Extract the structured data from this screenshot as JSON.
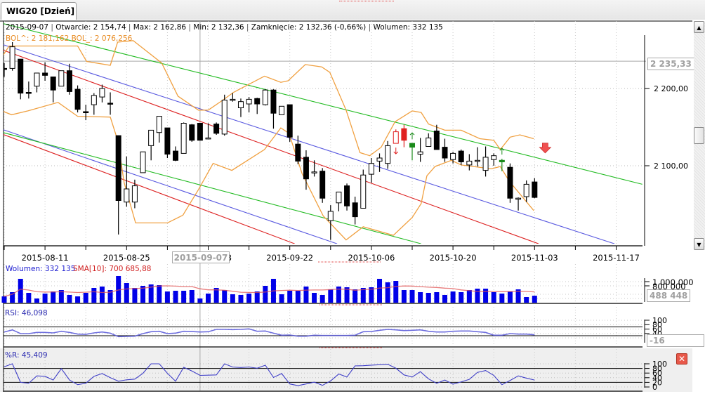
{
  "tab": {
    "label": "WIG20 [Dzień]"
  },
  "info_line": {
    "date": "2015-09-07",
    "open": "Otwarcie: 2 154,74",
    "max": "Max: 2 162,86",
    "min": "Min: 2 132,36",
    "close": "Zamknięcie: 2 132,36 (-0,66%)",
    "volume": "Wolumen: 332 135"
  },
  "bollinger_label": "BOL^: 2 181,162  BOL_: 2 076,256",
  "crosshair": {
    "price_label": "2 235,33",
    "price": 2235.33,
    "date_label": "2015-09-07",
    "index": 24
  },
  "price_axis": {
    "ticks": [
      {
        "value": 2200,
        "label": "2 200,00"
      },
      {
        "value": 2100,
        "label": "2 100,00"
      }
    ]
  },
  "date_axis": [
    {
      "index": 5,
      "label": "2015-08-11"
    },
    {
      "index": 15,
      "label": "2015-08-25"
    },
    {
      "index": 25,
      "label": "2015-09-08"
    },
    {
      "index": 35,
      "label": "2015-09-22"
    },
    {
      "index": 45,
      "label": "2015-10-06"
    },
    {
      "index": 55,
      "label": "2015-10-20"
    },
    {
      "index": 65,
      "label": "2015-11-03"
    },
    {
      "index": 75,
      "label": "2015-11-17"
    }
  ],
  "volume_panel": {
    "label": "Wolumen: 332 135",
    "sma_label": "SMA[10]: 700 685,88",
    "axis_ticks": [
      {
        "value": 1000000,
        "label": "1 000 000"
      },
      {
        "value": 800000,
        "label": "800 000"
      }
    ],
    "crosshair_box": "488 448"
  },
  "rsi_panel": {
    "label": "RSI: 46,098",
    "axis_ticks": [
      {
        "value": 100,
        "label": "100"
      },
      {
        "value": 80,
        "label": "80"
      },
      {
        "value": 60,
        "label": "60"
      },
      {
        "value": 40,
        "label": "40"
      }
    ],
    "crosshair_box": "-16",
    "levels": [
      70,
      30
    ]
  },
  "wr_panel": {
    "label": "%R: 45,409",
    "axis_ticks": [
      {
        "value": 100,
        "label": "100"
      },
      {
        "value": 80,
        "label": "80"
      },
      {
        "value": 60,
        "label": "60"
      },
      {
        "value": 40,
        "label": "40"
      },
      {
        "value": 20,
        "label": "20"
      },
      {
        "value": 0,
        "label": "0"
      }
    ],
    "levels": [
      80,
      20
    ],
    "close_icon": "close-icon"
  },
  "colors": {
    "up": "#ffffff",
    "down": "#000000",
    "bands": "#f0a040",
    "volume": "#0000e8",
    "sma": "#e05050",
    "rsi": "#5555d8",
    "wr": "#4040c8",
    "signal_red": "#e02020",
    "signal_green": "#1a8a1a",
    "line_green": "#22bb22",
    "line_blue": "#5a5ae0",
    "line_red": "#dd2222"
  },
  "chart_data": {
    "type": "candlestick",
    "title": "WIG20 [Dzień]",
    "ylim": [
      1999,
      2287
    ],
    "candles_ohlc": [
      [
        2226,
        2233,
        2215,
        2225
      ],
      [
        2226,
        2260,
        2223,
        2254
      ],
      [
        2238,
        2238,
        2186,
        2194
      ],
      [
        2195,
        2209,
        2187,
        2194
      ],
      [
        2203,
        2220,
        2195,
        2220
      ],
      [
        2220,
        2234,
        2210,
        2217
      ],
      [
        2215,
        2215,
        2182,
        2198
      ],
      [
        2203,
        2223,
        2203,
        2223
      ],
      [
        2223,
        2232,
        2192,
        2196
      ],
      [
        2199,
        2204,
        2169,
        2173
      ],
      [
        2170,
        2179,
        2159,
        2169
      ],
      [
        2179,
        2194,
        2166,
        2191
      ],
      [
        2189,
        2205,
        2182,
        2200
      ],
      [
        2181,
        2195,
        2166,
        2180
      ],
      [
        2139,
        2139,
        2011,
        2055
      ],
      [
        2053,
        2112,
        2047,
        2070
      ],
      [
        2053,
        2082,
        2045,
        2074
      ],
      [
        2091,
        2118,
        2091,
        2118
      ],
      [
        2126,
        2146,
        2107,
        2146
      ],
      [
        2143,
        2164,
        2130,
        2164
      ],
      [
        2149,
        2149,
        2110,
        2115
      ],
      [
        2119,
        2125,
        2106,
        2107
      ],
      [
        2116,
        2156,
        2116,
        2155
      ],
      [
        2153,
        2154,
        2131,
        2133
      ],
      [
        2155,
        2155,
        2133,
        2133
      ],
      [
        2136,
        2155,
        2135,
        2136
      ],
      [
        2154,
        2156,
        2140,
        2142
      ],
      [
        2141,
        2192,
        2139,
        2185
      ],
      [
        2186,
        2194,
        2183,
        2186
      ],
      [
        2175,
        2187,
        2163,
        2183
      ],
      [
        2180,
        2189,
        2169,
        2186
      ],
      [
        2187,
        2188,
        2167,
        2180
      ],
      [
        2179,
        2199,
        2178,
        2198
      ],
      [
        2198,
        2199,
        2148,
        2168
      ],
      [
        2166,
        2177,
        2166,
        2177
      ],
      [
        2179,
        2179,
        2131,
        2137
      ],
      [
        2128,
        2139,
        2102,
        2106
      ],
      [
        2111,
        2120,
        2069,
        2083
      ],
      [
        2092,
        2107,
        2086,
        2092
      ],
      [
        2093,
        2097,
        2052,
        2058
      ],
      [
        2029,
        2049,
        2004,
        2041
      ],
      [
        2052,
        2066,
        2041,
        2066
      ],
      [
        2074,
        2077,
        2042,
        2048
      ],
      [
        2052,
        2060,
        2024,
        2034
      ],
      [
        2045,
        2095,
        2045,
        2088
      ],
      [
        2089,
        2110,
        2078,
        2103
      ],
      [
        2106,
        2116,
        2092,
        2110
      ],
      [
        2103,
        2132,
        2096,
        2126
      ],
      [
        2129,
        2147,
        2129,
        2144
      ],
      [
        2148,
        2153,
        2124,
        2133
      ],
      [
        2129,
        2129,
        2107,
        2124
      ],
      [
        2115,
        2136,
        2105,
        2118
      ],
      [
        2125,
        2142,
        2125,
        2136
      ],
      [
        2145,
        2153,
        2121,
        2121
      ],
      [
        2124,
        2135,
        2105,
        2110
      ],
      [
        2108,
        2118,
        2103,
        2116
      ],
      [
        2119,
        2121,
        2101,
        2105
      ],
      [
        2101,
        2115,
        2094,
        2106
      ],
      [
        2107,
        2124,
        2099,
        2107
      ],
      [
        2094,
        2125,
        2086,
        2111
      ],
      [
        2108,
        2116,
        2100,
        2113
      ],
      [
        2107,
        2109,
        2093,
        2105
      ],
      [
        2098,
        2103,
        2052,
        2058
      ],
      [
        2058,
        2059,
        2042,
        2058
      ],
      [
        2060,
        2081,
        2053,
        2076
      ],
      [
        2079,
        2084,
        2058,
        2059
      ]
    ],
    "candle_highlights": {
      "48": "red-hollow",
      "49": "red",
      "50": "green",
      "61": "green"
    },
    "signals": [
      {
        "index": 48,
        "price": 2119,
        "type": "down",
        "color": "red"
      },
      {
        "index": 50,
        "price": 2139,
        "type": "up",
        "color": "green"
      },
      {
        "index": 61,
        "price": 2119,
        "type": "up",
        "color": "green"
      }
    ],
    "big_signal": {
      "index": 66.3,
      "price": 2122,
      "type": "down"
    },
    "bollinger_upper": [
      [
        -0.5,
        2237
      ],
      [
        0.6,
        2255
      ],
      [
        9,
        2255
      ],
      [
        10.1,
        2235
      ],
      [
        13,
        2230
      ],
      [
        13.9,
        2260
      ],
      [
        15.8,
        2262
      ],
      [
        19.3,
        2233
      ],
      [
        21.3,
        2190
      ],
      [
        23.8,
        2172
      ],
      [
        25,
        2172
      ],
      [
        26.8,
        2185
      ],
      [
        28.1,
        2195
      ],
      [
        31.9,
        2216
      ],
      [
        33.9,
        2208
      ],
      [
        34.8,
        2210
      ],
      [
        36.9,
        2231
      ],
      [
        38.9,
        2228
      ],
      [
        39.9,
        2221
      ],
      [
        41.9,
        2172
      ],
      [
        43.6,
        2117
      ],
      [
        44.8,
        2113
      ],
      [
        46.2,
        2124
      ],
      [
        47.9,
        2157
      ],
      [
        50,
        2171
      ],
      [
        51.1,
        2169
      ],
      [
        52,
        2154
      ],
      [
        54,
        2146
      ],
      [
        56,
        2146
      ],
      [
        58.3,
        2135
      ],
      [
        60,
        2133
      ],
      [
        60.8,
        2121
      ],
      [
        62,
        2137
      ],
      [
        63.2,
        2140
      ],
      [
        64.9,
        2135
      ]
    ],
    "bollinger_lower": [
      [
        -0.5,
        2172
      ],
      [
        0.9,
        2166
      ],
      [
        2.9,
        2171
      ],
      [
        6.6,
        2182
      ],
      [
        9,
        2164
      ],
      [
        13,
        2163
      ],
      [
        13.9,
        2133
      ],
      [
        14.7,
        2078
      ],
      [
        16.1,
        2026
      ],
      [
        20,
        2026
      ],
      [
        21.9,
        2036
      ],
      [
        23.8,
        2069
      ],
      [
        25.6,
        2103
      ],
      [
        27.9,
        2094
      ],
      [
        31.9,
        2121
      ],
      [
        33.9,
        2149
      ],
      [
        34.9,
        2142
      ],
      [
        36.5,
        2090
      ],
      [
        39.1,
        2035
      ],
      [
        41.9,
        2004
      ],
      [
        44,
        2021
      ],
      [
        47.7,
        2010
      ],
      [
        50,
        2033
      ],
      [
        51.1,
        2051
      ],
      [
        51.8,
        2087
      ],
      [
        52.8,
        2099
      ],
      [
        54.8,
        2107
      ],
      [
        56,
        2101
      ],
      [
        59.7,
        2096
      ],
      [
        60.8,
        2099
      ],
      [
        61.9,
        2080
      ],
      [
        64.9,
        2042
      ]
    ],
    "trend_lines": [
      {
        "color": "green",
        "from": [
          -0.5,
          2285
        ],
        "to": [
          78.2,
          2076
        ]
      },
      {
        "color": "blue",
        "from": [
          -0.5,
          2258
        ],
        "to": [
          74.8,
          1999
        ]
      },
      {
        "color": "red",
        "from": [
          -0.5,
          2251
        ],
        "to": [
          65.5,
          1999
        ]
      },
      {
        "color": "blue",
        "from": [
          -0.5,
          2148
        ],
        "to": [
          40.8,
          1999
        ]
      },
      {
        "color": "green",
        "from": [
          -0.5,
          2144
        ],
        "to": [
          51.1,
          1999
        ]
      },
      {
        "color": "red",
        "from": [
          -0.5,
          2142
        ],
        "to": [
          35.6,
          1999
        ]
      }
    ],
    "volume": [
      300000,
      500000,
      1133000,
      467000,
      200000,
      433000,
      533000,
      600000,
      367000,
      300000,
      467000,
      700000,
      767000,
      600000,
      1267000,
      933000,
      700000,
      800000,
      867000,
      833000,
      533000,
      567000,
      567000,
      600000,
      200000,
      433000,
      700000,
      600000,
      400000,
      367000,
      433000,
      533000,
      800000,
      1133000,
      400000,
      567000,
      567000,
      767000,
      467000,
      367000,
      633000,
      767000,
      733000,
      633000,
      700000,
      733000,
      1133000,
      967000,
      1033000,
      600000,
      600000,
      500000,
      467000,
      500000,
      367000,
      533000,
      500000,
      600000,
      667000,
      667000,
      500000,
      433000,
      533000,
      633000,
      267000,
      332135
    ],
    "rsi": [
      46.7,
      56.4,
      39.4,
      39.4,
      44.7,
      44.7,
      42.6,
      50.0,
      44.7,
      37.2,
      36.2,
      42.6,
      46.7,
      41.5,
      25.6,
      26.7,
      27.8,
      39.4,
      47.9,
      50.0,
      39.4,
      41.5,
      50.0,
      48.9,
      46.7,
      47.9,
      58.5,
      58.5,
      57.5,
      58.5,
      60.8,
      50.0,
      51.1,
      41.5,
      32.1,
      33.1,
      27.8,
      27.8,
      32.1,
      31.0,
      31.0,
      31.0,
      31.0,
      32.1,
      47.9,
      48.9,
      54.3,
      58.5,
      56.4,
      53.2,
      54.3,
      56.4,
      50.0,
      46.7,
      46.7,
      50.0,
      51.1,
      51.1,
      47.9,
      44.7,
      32.1,
      32.1,
      39.4,
      37.2,
      37.2,
      34.1
    ],
    "williams_r": [
      87,
      100,
      20,
      16,
      48,
      46,
      30,
      79,
      30,
      10,
      16,
      46,
      58,
      40,
      25,
      31,
      34,
      59,
      100,
      100,
      59,
      25,
      85,
      69,
      50,
      51,
      52,
      100,
      86,
      84,
      86,
      81,
      94,
      41,
      58,
      13,
      6,
      13,
      21,
      7,
      26,
      56,
      43,
      91,
      92,
      94,
      96,
      98,
      81,
      52,
      43,
      66,
      35,
      16,
      30,
      12,
      22,
      33,
      63,
      71,
      50,
      10,
      28,
      48,
      38,
      30
    ]
  }
}
